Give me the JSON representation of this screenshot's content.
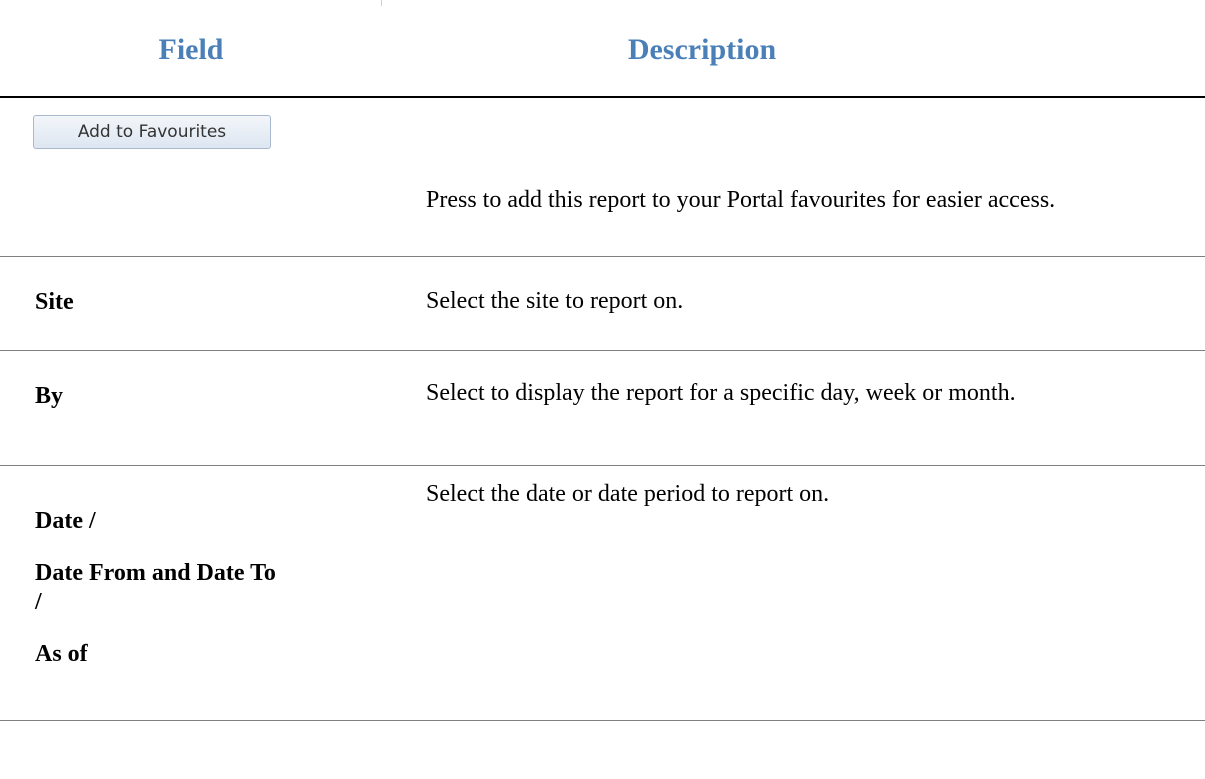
{
  "table": {
    "headers": {
      "field": "Field",
      "description": "Description"
    },
    "rows": [
      {
        "button_label": "Add to Favourites",
        "description": "Press to add this report to your Portal favourites for easier access."
      },
      {
        "field": "Site",
        "description": "Select the site to report on."
      },
      {
        "field": "By",
        "description": "Select to display the report for a specific day, week or month."
      },
      {
        "field_lines": [
          "Date /",
          "Date From and Date To",
          "/",
          "As of"
        ],
        "description": "Select the date or date period to report on."
      }
    ]
  },
  "colors": {
    "header_text": "#4a7fb8",
    "rule_thick": "#000000",
    "rule_thin": "#7f7f7f"
  }
}
